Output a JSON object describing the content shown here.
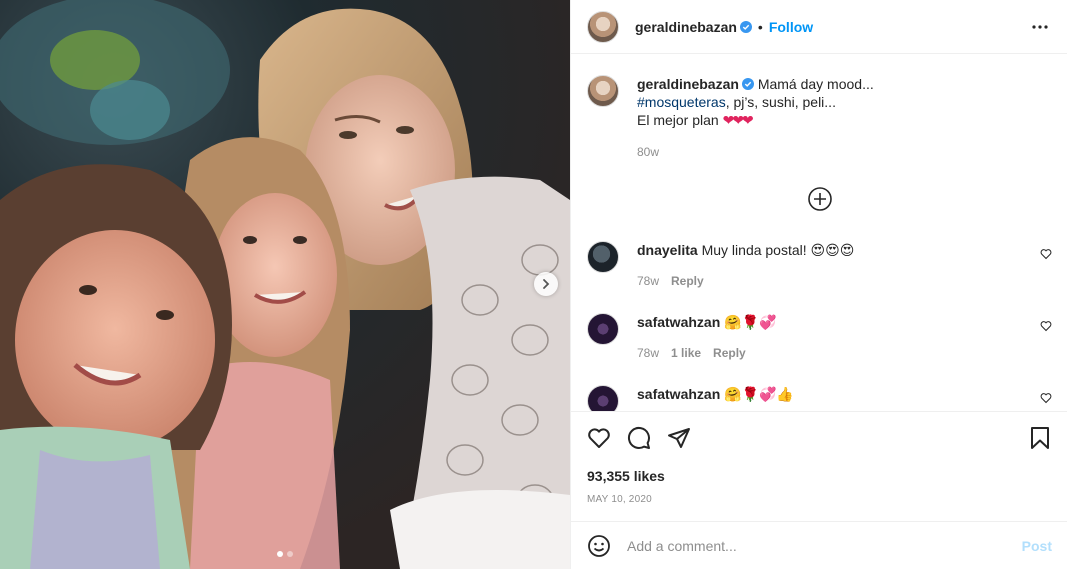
{
  "post": {
    "username": "geraldinebazan",
    "verified": true,
    "follow_label": "Follow",
    "separator": "•",
    "media": {
      "photo_count": 2,
      "active_index": 0
    },
    "caption": {
      "text_start": "Mamá day mood...",
      "hashtag": "#mosqueteras",
      "text_line2_rest": ", pj’s, sushi, peli...",
      "text_line3": "El mejor plan ",
      "hearts": "❤❤❤",
      "time": "80w"
    },
    "comments": [
      {
        "username": "dnayelita",
        "text": "Muy linda postal! ",
        "emoji": "😍😍😍",
        "time": "78w",
        "likes": "",
        "reply_label": "Reply"
      },
      {
        "username": "safatwahzan",
        "text": "",
        "emoji": "🤗🌹💞",
        "time": "78w",
        "likes": "1 like",
        "reply_label": "Reply"
      },
      {
        "username": "safatwahzan",
        "text": "",
        "emoji": "🤗🌹💞👍"
      }
    ],
    "likes_text": "93,355 likes",
    "date": "MAY 10, 2020",
    "composer": {
      "placeholder": "Add a comment...",
      "post_label": "Post"
    }
  }
}
